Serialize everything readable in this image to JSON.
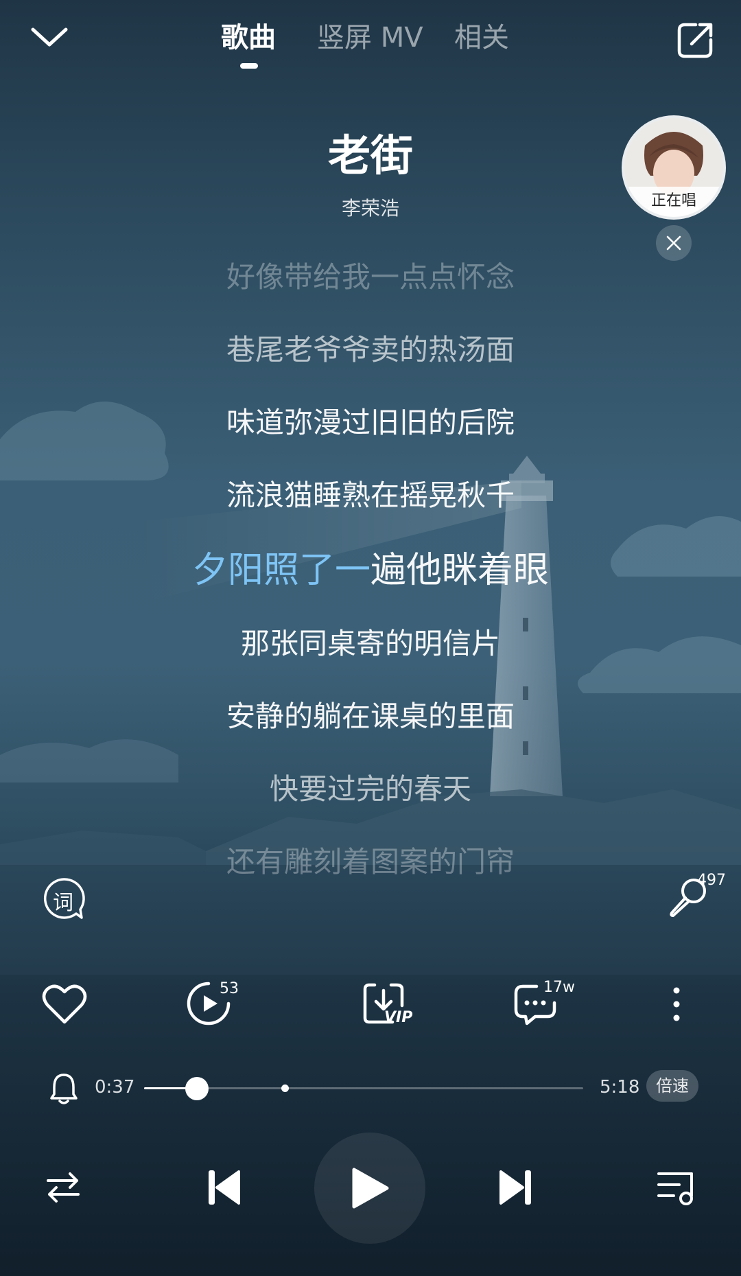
{
  "header": {
    "tabs": [
      {
        "label": "歌曲",
        "active": true
      },
      {
        "label": "竖屏 MV",
        "active": false
      },
      {
        "label": "相关",
        "active": false
      }
    ],
    "collapse_icon": "chevron-down-icon",
    "share_icon": "share-icon"
  },
  "song": {
    "title": "老街",
    "artist": "李荣浩"
  },
  "singing_bubble": {
    "label": "正在唱",
    "close_icon": "close-icon"
  },
  "lyrics": {
    "lines": [
      "好像带给我一点点怀念",
      "巷尾老爷爷卖的热汤面",
      "味道弥漫过旧旧的后院",
      "流浪猫睡熟在摇晃秋千",
      "那张同桌寄的明信片",
      "安静的躺在课桌的里面",
      "快要过完的春天",
      "还有雕刻着图案的门帘"
    ],
    "current_sung": "夕阳照了一",
    "current_rest": "遍他眯着眼"
  },
  "side_buttons": {
    "lyrics_mode_label": "词",
    "karaoke_count": "497"
  },
  "actions": {
    "like_icon": "heart-icon",
    "video_count": "53",
    "download_badge": "VIP",
    "comment_count": "17w",
    "more_icon": "more-vertical-icon"
  },
  "playback": {
    "current_time": "0:37",
    "total_time": "5:18",
    "progress": 0.12,
    "marker": 0.32,
    "speed_label": "倍速"
  },
  "controls": {
    "repeat_icon": "repeat-icon",
    "prev_icon": "previous-icon",
    "play_icon": "play-icon",
    "next_icon": "next-icon",
    "playlist_icon": "playlist-icon"
  },
  "colors": {
    "accent": "#7ec4f5",
    "background_top": "#1f3546",
    "background_bottom": "#111f2b"
  }
}
